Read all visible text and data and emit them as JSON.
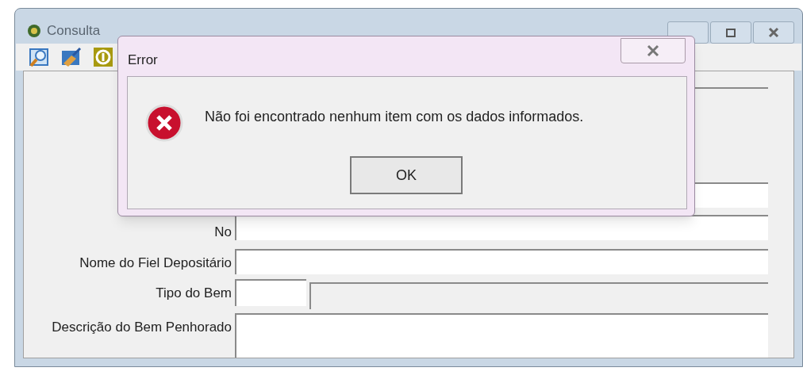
{
  "window": {
    "title": "Consulta"
  },
  "form": {
    "rows": [
      {
        "kind": "text",
        "disabled": true
      },
      {
        "kind": "text",
        "disabled": false
      },
      {
        "kind": "text",
        "label": "No",
        "disabled": false
      },
      {
        "kind": "text",
        "label": "Nome do Fiel Depositário",
        "disabled": false
      },
      {
        "kind": "code",
        "label": "Tipo do Bem",
        "disabled": false
      },
      {
        "kind": "memo",
        "label": "Descrição do Bem Penhorado",
        "disabled": false
      }
    ]
  },
  "dialog": {
    "title": "Error",
    "message": "Não foi encontrado nenhum item com os dados informados.",
    "buttons": [
      "OK"
    ]
  }
}
